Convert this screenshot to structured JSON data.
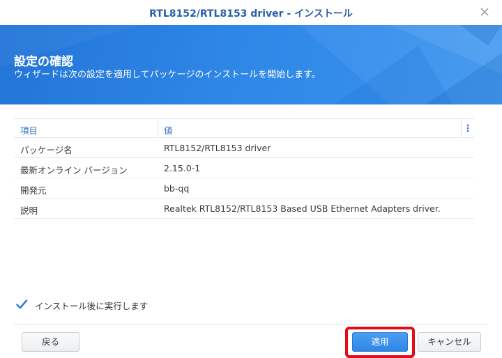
{
  "window": {
    "title": "RTL8152/RTL8153 driver - インストール"
  },
  "banner": {
    "heading": "設定の確認",
    "subtitle": "ウィザードは次の設定を適用してパッケージのインストールを開始します。"
  },
  "table": {
    "headers": [
      "項目",
      "値"
    ],
    "rows": [
      {
        "key": "パッケージ名",
        "value": "RTL8152/RTL8153 driver"
      },
      {
        "key": "最新オンライン バージョン",
        "value": "2.15.0-1"
      },
      {
        "key": "開発元",
        "value": "bb-qq"
      },
      {
        "key": "説明",
        "value": "Realtek RTL8152/RTL8153 Based USB Ethernet Adapters driver."
      }
    ]
  },
  "options": {
    "run_after_install_label": "インストール後に実行します",
    "run_after_install_checked": true
  },
  "footer": {
    "back_label": "戻る",
    "apply_label": "適用",
    "cancel_label": "キャンセル"
  },
  "colors": {
    "accent": "#2f86e4",
    "title_text": "#2a5fa8",
    "highlight_border": "#e30b17"
  },
  "icons": {
    "close": "close-icon",
    "column_menu": "vertical-dots-icon",
    "checkbox": "checkmark-icon"
  }
}
